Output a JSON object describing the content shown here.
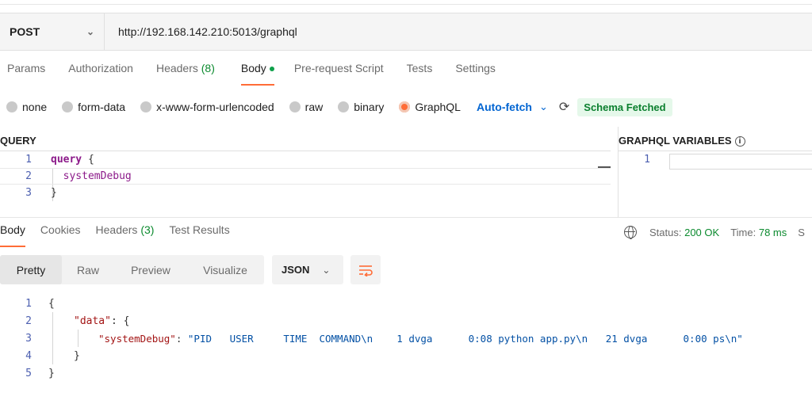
{
  "request": {
    "method": "POST",
    "url": "http://192.168.142.210:5013/graphql"
  },
  "request_tabs": [
    {
      "label": "Params"
    },
    {
      "label": "Authorization"
    },
    {
      "label": "Headers",
      "count": "(8)"
    },
    {
      "label": "Body"
    },
    {
      "label": "Pre-request Script"
    },
    {
      "label": "Tests"
    },
    {
      "label": "Settings"
    }
  ],
  "body_types": [
    "none",
    "form-data",
    "x-www-form-urlencoded",
    "raw",
    "binary",
    "GraphQL"
  ],
  "selected_body_type": "GraphQL",
  "auto_fetch_label": "Auto-fetch",
  "schema_status": "Schema Fetched",
  "query_panel": {
    "label": "QUERY",
    "lines": [
      {
        "num": "1",
        "kw": "query",
        "rest": " {"
      },
      {
        "num": "2",
        "text": "  systemDebug"
      },
      {
        "num": "3",
        "text": "}"
      }
    ]
  },
  "variables_panel": {
    "label": "GRAPHQL VARIABLES",
    "lines": [
      {
        "num": "1"
      }
    ]
  },
  "response_tabs": [
    {
      "label": "Body"
    },
    {
      "label": "Cookies"
    },
    {
      "label": "Headers",
      "count": "(3)"
    },
    {
      "label": "Test Results"
    }
  ],
  "status": {
    "status_label": "Status:",
    "status_value": "200 OK",
    "time_label": "Time:",
    "time_value": "78 ms",
    "size_label": "S"
  },
  "view_modes": [
    "Pretty",
    "Raw",
    "Preview",
    "Visualize"
  ],
  "selected_view_mode": "Pretty",
  "format": "JSON",
  "response_lines": [
    {
      "num": "1",
      "text": "{"
    },
    {
      "num": "2",
      "key": "\"data\"",
      "rest": ": {"
    },
    {
      "num": "3",
      "key": "\"systemDebug\"",
      "sep": ": ",
      "value": "\"PID   USER     TIME  COMMAND\\n    1 dvga      0:08 python app.py\\n   21 dvga      0:00 ps\\n\""
    },
    {
      "num": "4",
      "text": "}"
    },
    {
      "num": "5",
      "text": "}"
    }
  ],
  "colors": {
    "accent": "#ff6c37",
    "auto_fetch": "#0265d2",
    "success": "#0b8a2e"
  }
}
